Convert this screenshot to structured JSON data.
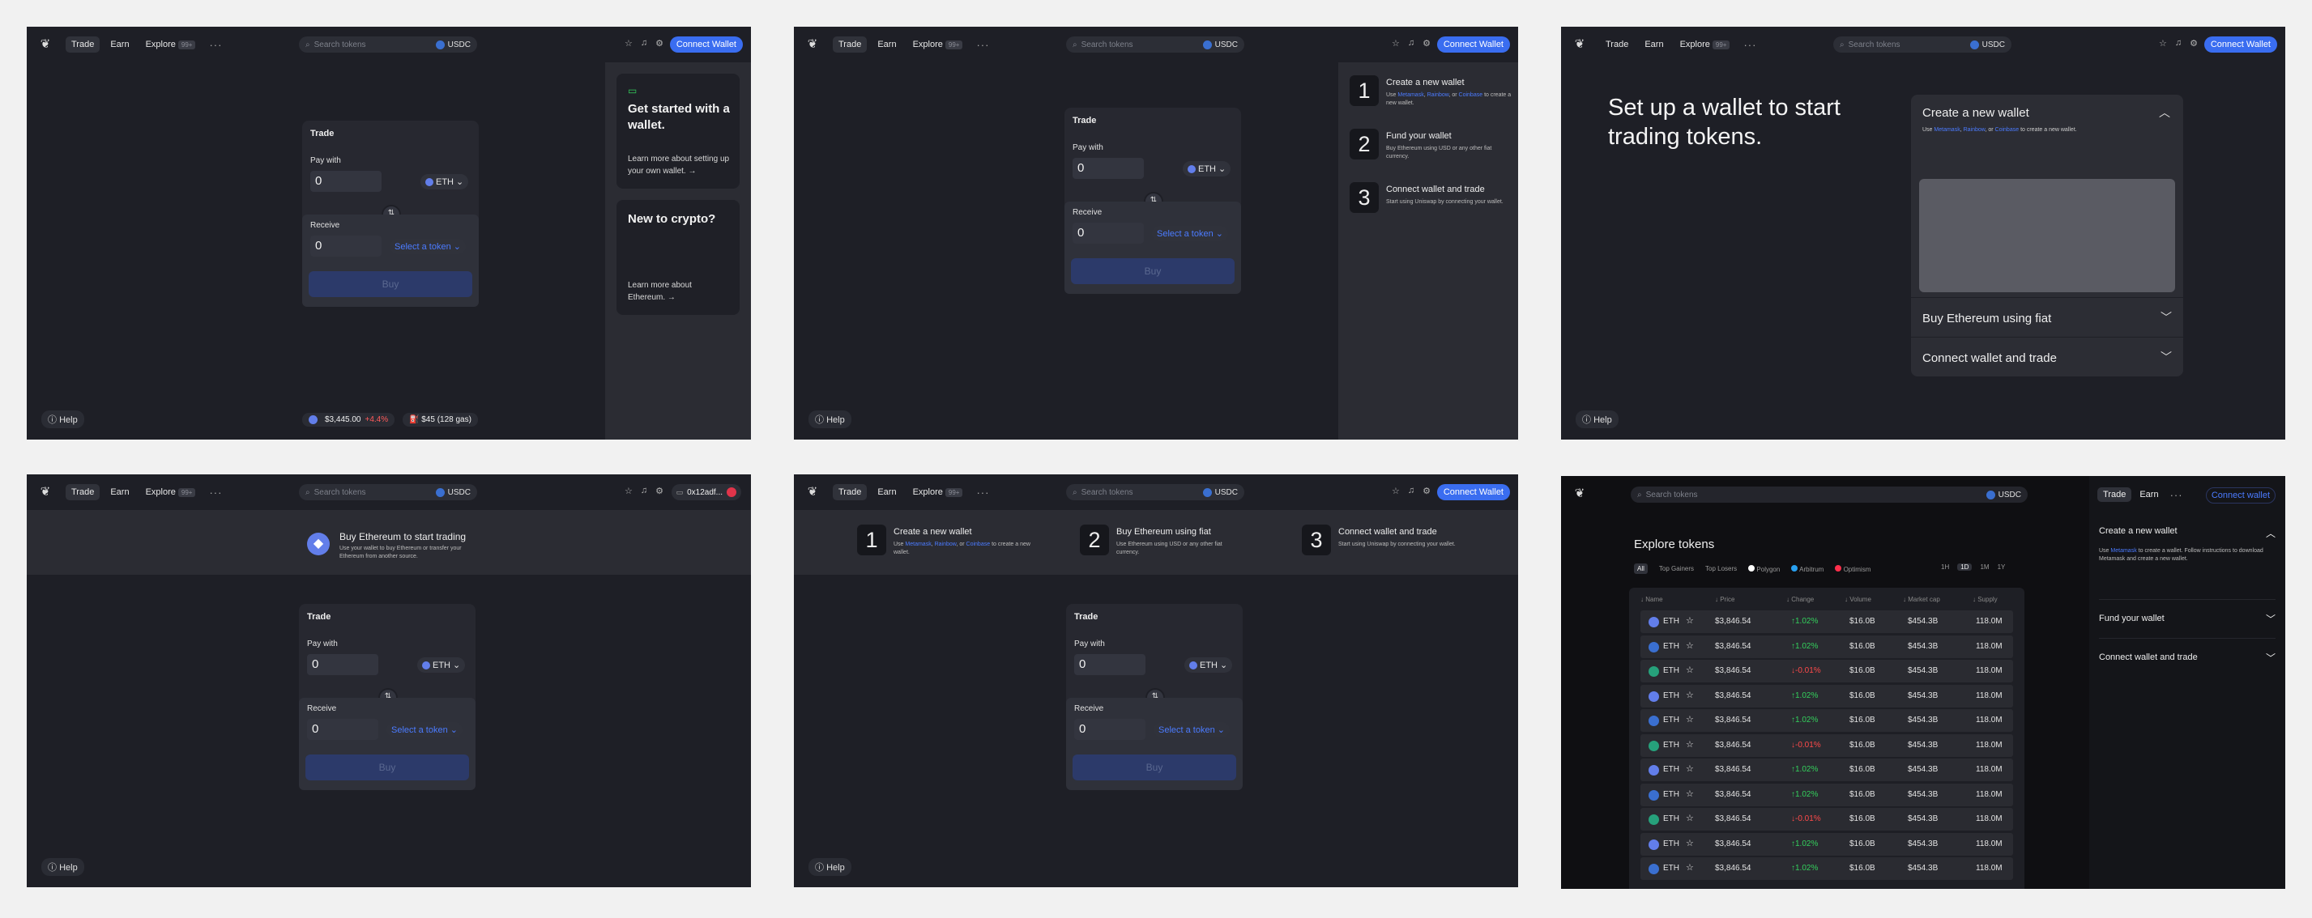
{
  "common": {
    "nav": {
      "trade": "Trade",
      "earn": "Earn",
      "explore": "Explore",
      "explore_badge": "99+",
      "more": "···"
    },
    "search": {
      "placeholder": "Search tokens",
      "currency": "USDC"
    },
    "connect": "Connect Wallet",
    "connect_lower": "Connect wallet",
    "help": "Help",
    "swap": {
      "title": "Trade",
      "pay_with": "Pay with",
      "pay_amount": "0",
      "pay_token": "ETH",
      "receive": "Receive",
      "receive_amount": "0",
      "select_token": "Select a token",
      "buy": "Buy"
    },
    "icons": {
      "logo": "unicorn-logo-icon",
      "search": "search-icon",
      "star": "star-icon",
      "bell": "bell-icon",
      "gear": "gear-icon",
      "swap": "swap-arrows-icon"
    }
  },
  "panel1": {
    "card1_title": "Get started with a wallet.",
    "card1_link": "Learn more about setting up your own wallet. →",
    "card2_title": "New to crypto?",
    "card2_link": "Learn more about Ethereum. →",
    "price": "$3,445.00",
    "change": "+4.4%",
    "gas": "$45 (128 gas)"
  },
  "steps": {
    "s1_num": "1",
    "s1_title": "Create a new wallet",
    "s1_use": "Use",
    "s1_a": "Metamask",
    "s1_b": "Rainbow",
    "s1_or": ", or",
    "s1_c": "Coinbase",
    "s1_tail": "to create a new wallet.",
    "s2_num": "2",
    "s2_title": "Fund your wallet",
    "s2_desc": "Buy Ethereum using USD or any other fiat currency.",
    "s3_num": "3",
    "s3_title": "Connect wallet and trade",
    "s3_desc": "Start using Uniswap by connecting your wallet."
  },
  "panel3": {
    "headline": "Set up a wallet to start trading tokens.",
    "acc1_title": "Create a new wallet",
    "acc2_title": "Buy Ethereum using fiat",
    "acc3_title": "Connect wallet and trade"
  },
  "panel4": {
    "banner_title": "Buy Ethereum to start trading",
    "banner_desc": "Use your wallet to buy Ethereum or transfer your Ethereum from another source.",
    "address": "0x12adf..."
  },
  "panel5": {
    "s2_title": "Buy Ethereum using fiat",
    "s2_desc": "Use Ethereum using USD or any other fiat currency."
  },
  "panel6": {
    "title": "Explore tokens",
    "filters": [
      "All",
      "Top Gainers",
      "Top Losers",
      "Polygon",
      "Arbitrum",
      "Optimism"
    ],
    "periods": [
      "1H",
      "1D",
      "1M",
      "1Y"
    ],
    "columns": [
      "↓ Name",
      "↓ Price",
      "↓ Change",
      "↓ Volume",
      "↓ Market cap",
      "↓ Supply"
    ],
    "rows": [
      {
        "coin": "ETH",
        "price": "$3,846.54",
        "change": "↑1.02%",
        "dir": "up",
        "volume": "$16.0B",
        "mcap": "$454.3B",
        "supply": "118.0M",
        "color": "#627eea"
      },
      {
        "coin": "ETH",
        "price": "$3,846.54",
        "change": "↑1.02%",
        "dir": "up",
        "volume": "$16.0B",
        "mcap": "$454.3B",
        "supply": "118.0M",
        "color": "#3a6fd0"
      },
      {
        "coin": "ETH",
        "price": "$3,846.54",
        "change": "↓-0.01%",
        "dir": "down",
        "volume": "$16.0B",
        "mcap": "$454.3B",
        "supply": "118.0M",
        "color": "#26a17b"
      },
      {
        "coin": "ETH",
        "price": "$3,846.54",
        "change": "↑1.02%",
        "dir": "up",
        "volume": "$16.0B",
        "mcap": "$454.3B",
        "supply": "118.0M",
        "color": "#627eea"
      },
      {
        "coin": "ETH",
        "price": "$3,846.54",
        "change": "↑1.02%",
        "dir": "up",
        "volume": "$16.0B",
        "mcap": "$454.3B",
        "supply": "118.0M",
        "color": "#3a6fd0"
      },
      {
        "coin": "ETH",
        "price": "$3,846.54",
        "change": "↓-0.01%",
        "dir": "down",
        "volume": "$16.0B",
        "mcap": "$454.3B",
        "supply": "118.0M",
        "color": "#26a17b"
      },
      {
        "coin": "ETH",
        "price": "$3,846.54",
        "change": "↑1.02%",
        "dir": "up",
        "volume": "$16.0B",
        "mcap": "$454.3B",
        "supply": "118.0M",
        "color": "#627eea"
      },
      {
        "coin": "ETH",
        "price": "$3,846.54",
        "change": "↑1.02%",
        "dir": "up",
        "volume": "$16.0B",
        "mcap": "$454.3B",
        "supply": "118.0M",
        "color": "#3a6fd0"
      },
      {
        "coin": "ETH",
        "price": "$3,846.54",
        "change": "↓-0.01%",
        "dir": "down",
        "volume": "$16.0B",
        "mcap": "$454.3B",
        "supply": "118.0M",
        "color": "#26a17b"
      },
      {
        "coin": "ETH",
        "price": "$3,846.54",
        "change": "↑1.02%",
        "dir": "up",
        "volume": "$16.0B",
        "mcap": "$454.3B",
        "supply": "118.0M",
        "color": "#627eea"
      },
      {
        "coin": "ETH",
        "price": "$3,846.54",
        "change": "↑1.02%",
        "dir": "up",
        "volume": "$16.0B",
        "mcap": "$454.3B",
        "supply": "118.0M",
        "color": "#3a6fd0"
      }
    ],
    "side_create_desc": "instructions to download Metamask and create a new wallet.",
    "side_create_use": "Use",
    "side_create_link": "Metamask",
    "side_create_mid": "to create a wallet. Follow",
    "side_fund": "Fund your wallet"
  }
}
